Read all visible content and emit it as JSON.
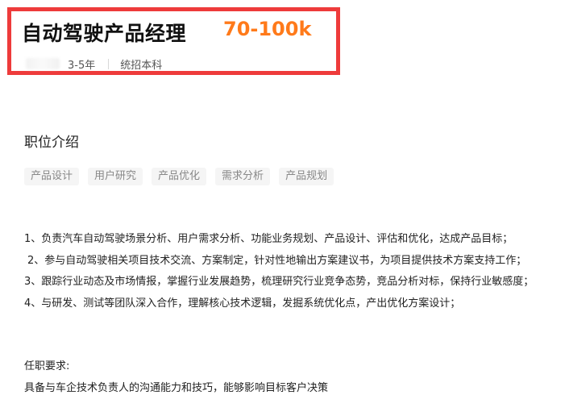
{
  "job": {
    "title": "自动驾驶产品经理",
    "salary": "70-100k",
    "experience": "3-5年",
    "education": "统招本科"
  },
  "description": {
    "section_title": "职位介绍",
    "tags": [
      "产品设计",
      "用户研究",
      "产品优化",
      "需求分析",
      "产品规划"
    ],
    "duties": [
      "1、负责汽车自动驾驶场景分析、用户需求分析、功能业务规划、产品设计、评估和优化，达成产品目标；",
      "2、参与自动驾驶相关项目技术交流、方案制定，针对性地输出方案建议书，为项目提供技术方案支持工作；",
      "3、跟踪行业动态及市场情报，掌握行业发展趋势，梳理研究行业竞争态势，竞品分析对标，保持行业敏感度；",
      "4、与研发、测试等团队深入合作，理解核心技术逻辑，发掘系统优化点，产出优化方案设计；"
    ],
    "requirements_title": "任职要求:",
    "requirements": [
      "具备与车企技术负责人的沟通能力和技巧，能够影响目标客户决策"
    ]
  },
  "colors": {
    "highlight_border": "#ee3b3b",
    "salary": "#ff7a1a",
    "tag_background": "#f5f5f5"
  }
}
